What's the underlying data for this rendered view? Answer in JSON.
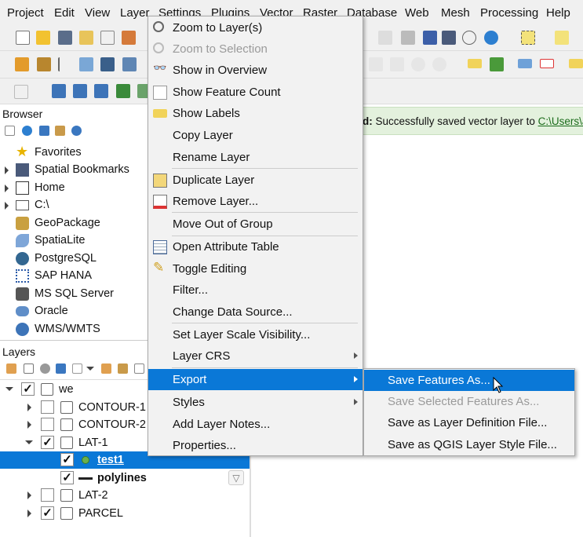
{
  "menubar": [
    "Project",
    "Edit",
    "View",
    "Layer",
    "Settings",
    "Plugins",
    "Vector",
    "Raster",
    "Database",
    "Web",
    "Mesh",
    "Processing",
    "Help"
  ],
  "message": {
    "prefix": "d:",
    "text": " Successfully saved vector layer to ",
    "link": "C:\\Users\\a"
  },
  "browser": {
    "title": "Browser",
    "items": [
      "Favorites",
      "Spatial Bookmarks",
      "Home",
      "C:\\",
      "GeoPackage",
      "SpatiaLite",
      "PostgreSQL",
      "SAP HANA",
      "MS SQL Server",
      "Oracle",
      "WMS/WMTS"
    ]
  },
  "layers": {
    "title": "Layers",
    "tree": [
      {
        "label": "we",
        "checked": true
      },
      {
        "label": "CONTOUR-1",
        "checked": false
      },
      {
        "label": "CONTOUR-2",
        "checked": false
      },
      {
        "label": "LAT-1",
        "checked": true
      },
      {
        "label": "test1",
        "checked": true
      },
      {
        "label": "polylines",
        "checked": true
      },
      {
        "label": "LAT-2",
        "checked": false
      },
      {
        "label": "PARCEL",
        "checked": true
      }
    ]
  },
  "context_menu": [
    "Zoom to Layer(s)",
    "Zoom to Selection",
    "Show in Overview",
    "Show Feature Count",
    "Show Labels",
    "Copy Layer",
    "Rename Layer",
    "Duplicate Layer",
    "Remove Layer...",
    "Move Out of Group",
    "Open Attribute Table",
    "Toggle Editing",
    "Filter...",
    "Change Data Source...",
    "Set Layer Scale Visibility...",
    "Layer CRS",
    "Export",
    "Styles",
    "Add Layer Notes...",
    "Properties..."
  ],
  "export_submenu": [
    "Save Features As...",
    "Save Selected Features As...",
    "Save as Layer Definition File...",
    "Save as QGIS Layer Style File..."
  ],
  "colors": {
    "highlight": "#0a78d7",
    "message_bg": "#e3f1dd"
  }
}
